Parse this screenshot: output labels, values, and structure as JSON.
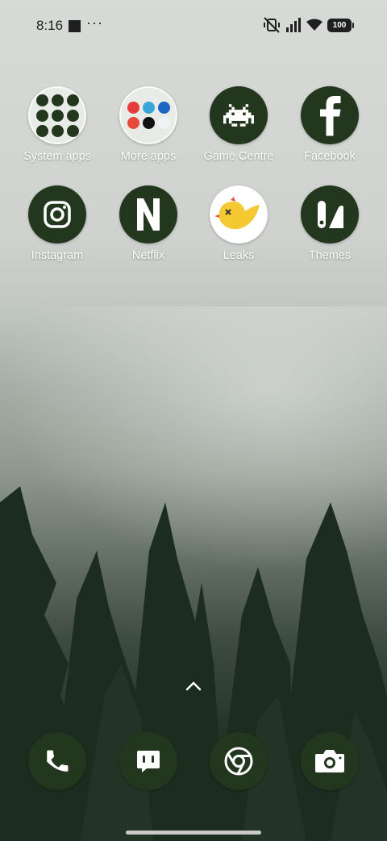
{
  "status_bar": {
    "time": "8:16",
    "more": "···",
    "battery": "100",
    "icons": [
      "screenshot-square-icon",
      "mute-vibrate-icon",
      "signal-icon",
      "wifi-icon",
      "battery-icon"
    ]
  },
  "apps_row1": [
    {
      "label": "System apps",
      "icon": "folder-icon"
    },
    {
      "label": "More apps",
      "icon": "folder-icon"
    },
    {
      "label": "Game Centre",
      "icon": "space-invader-icon"
    },
    {
      "label": "Facebook",
      "icon": "facebook-f-icon"
    }
  ],
  "apps_row2": [
    {
      "label": "Instagram",
      "icon": "instagram-camera-icon"
    },
    {
      "label": "Netflix",
      "icon": "netflix-n-icon"
    },
    {
      "label": "Leaks",
      "icon": "leaks-bird-icon"
    },
    {
      "label": "Themes",
      "icon": "themes-icon"
    }
  ],
  "dock": [
    {
      "icon": "phone-icon"
    },
    {
      "icon": "messages-icon"
    },
    {
      "icon": "chrome-icon"
    },
    {
      "icon": "camera-icon"
    }
  ],
  "colors": {
    "icon_bg": "#23371f",
    "icon_fg": "#ffffff",
    "label": "#ffffff"
  }
}
